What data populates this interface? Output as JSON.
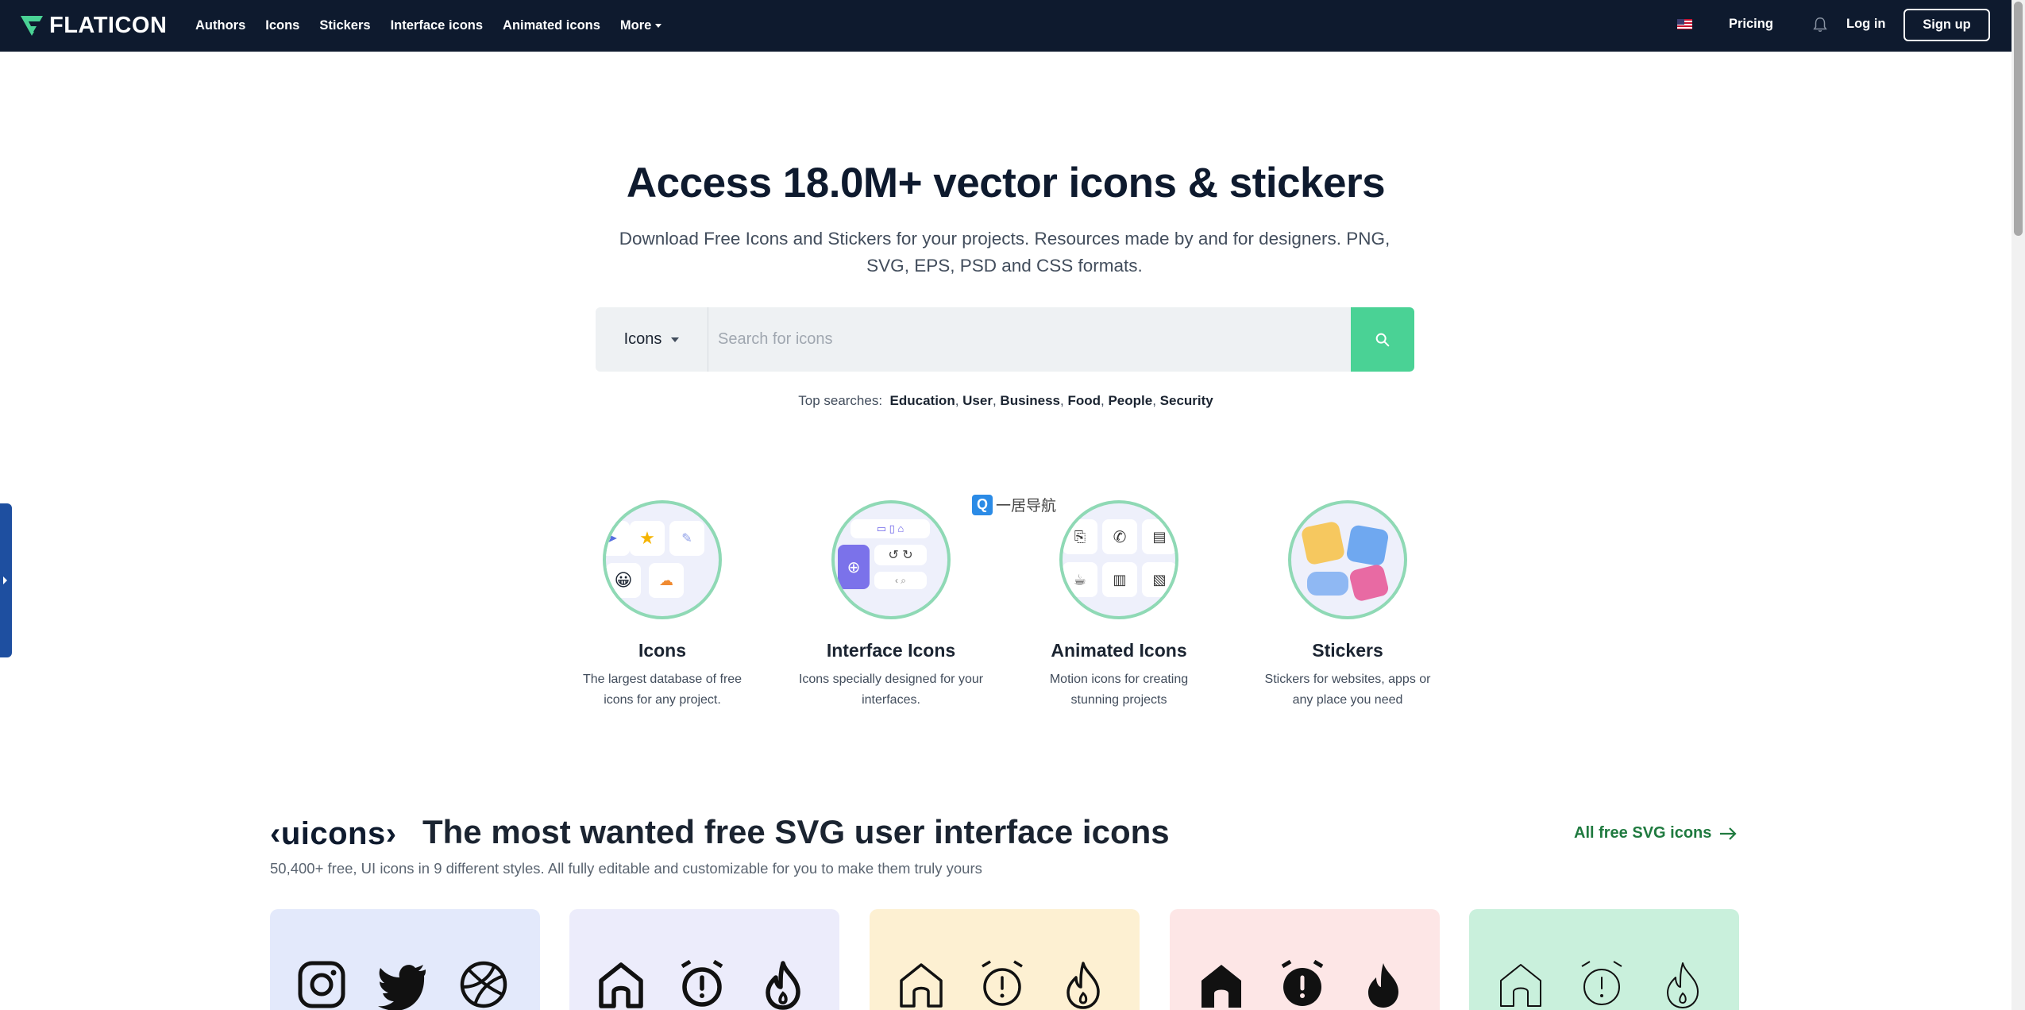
{
  "header": {
    "logo_text": "FLATICON",
    "nav": [
      {
        "label": "Authors"
      },
      {
        "label": "Icons"
      },
      {
        "label": "Stickers"
      },
      {
        "label": "Interface icons"
      },
      {
        "label": "Animated icons"
      },
      {
        "label": "More"
      }
    ],
    "pricing_label": "Pricing",
    "login_label": "Log in",
    "signup_label": "Sign up",
    "flag_icon": "us-flag-icon",
    "bell_icon": "bell-icon"
  },
  "hero": {
    "title": "Access 18.0M+ vector icons & stickers",
    "subtitle": "Download Free Icons and Stickers for your projects. Resources made by and for designers. PNG, SVG, EPS, PSD and CSS formats."
  },
  "search": {
    "type_selected": "Icons",
    "placeholder": "Search for icons",
    "button_icon": "search-icon",
    "button_color": "#4ad295"
  },
  "top_searches": {
    "label": "Top searches:",
    "items": [
      "Education",
      "User",
      "Business",
      "Food",
      "People",
      "Security"
    ]
  },
  "categories": [
    {
      "name": "Icons",
      "desc": "The largest database of free icons for any project."
    },
    {
      "name": "Interface Icons",
      "desc": "Icons specially designed for your interfaces."
    },
    {
      "name": "Animated Icons",
      "desc": "Motion icons for creating stunning projects"
    },
    {
      "name": "Stickers",
      "desc": "Stickers for websites, apps or any place you need"
    }
  ],
  "watermark": {
    "badge": "Q",
    "text": "一居导航"
  },
  "uicons": {
    "logo": "‹uicons›",
    "title": "The most wanted free SVG user interface icons",
    "subtitle": "50,400+ free, UI icons in 9 different styles. All fully editable and customizable for you to make them truly yours",
    "all_link": "All free SVG icons",
    "link_color": "#1f7a3f",
    "cards": [
      {
        "bg": "#e3e9fb",
        "icons": [
          "instagram-icon",
          "twitter-icon",
          "dribbble-icon"
        ]
      },
      {
        "bg": "#ececfb",
        "icons": [
          "home-icon",
          "alarm-icon",
          "flame-icon"
        ]
      },
      {
        "bg": "#fdf0d2",
        "icons": [
          "home-icon",
          "alarm-icon",
          "flame-icon"
        ]
      },
      {
        "bg": "#fde6e6",
        "icons": [
          "home-icon",
          "alarm-icon",
          "flame-icon"
        ]
      },
      {
        "bg": "#c9f0dc",
        "icons": [
          "home-icon",
          "alarm-icon",
          "flame-icon"
        ]
      }
    ]
  }
}
